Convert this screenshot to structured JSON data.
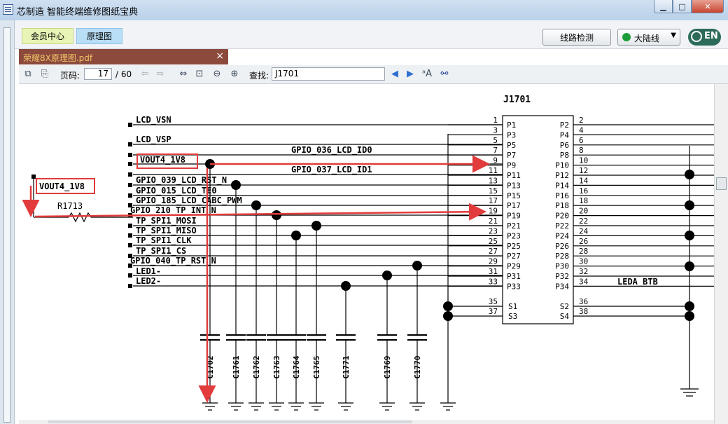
{
  "window": {
    "title": "芯制造 智能终端维修图纸宝典",
    "min": "▁",
    "max": "□",
    "close": "✕"
  },
  "nav": {
    "member_tab": "会员中心",
    "schematic_tab": "原理图",
    "line_check": "线路检测",
    "region": "大陆线",
    "lang": "EN"
  },
  "doc_tab": {
    "name": "荣耀8X原理图.pdf",
    "close": "×"
  },
  "toolbar": {
    "page_label": "页码:",
    "page_current": "17",
    "page_total": "/ 60",
    "find_label": "查找:",
    "find_value": "J1701"
  },
  "schematic": {
    "component": "J1701",
    "left_nets": [
      "LCD_VSN",
      "LCD_VSP",
      "GPIO_036_LCD_ID0",
      "VOUT4_1V8",
      "GPIO_037_LCD_ID1",
      "GPIO_039_LCD_RST_N",
      "GPIO_015_LCD_TE0",
      "GPIO_185_LCD_CABC_PWM",
      "GPIO_210_TP_INT_N",
      "TP_SPI1_MOSI",
      "TP_SPI1_MISO",
      "TP_SPI1_CLK",
      "TP_SPI1_CS",
      "GPIO_040_TP_RST_N",
      "LED1-",
      "LED2-"
    ],
    "left_pin_nums": [
      "1",
      "3",
      "5",
      "7",
      "9",
      "11",
      "13",
      "15",
      "17",
      "19",
      "21",
      "23",
      "25",
      "27",
      "29",
      "31",
      "33"
    ],
    "left_pin_names": [
      "P1",
      "P3",
      "P5",
      "P7",
      "P9",
      "P11",
      "P13",
      "P15",
      "P17",
      "P19",
      "P21",
      "P23",
      "P25",
      "P27",
      "P29",
      "P31",
      "P33"
    ],
    "right_pin_nums": [
      "2",
      "4",
      "6",
      "8",
      "10",
      "12",
      "14",
      "16",
      "18",
      "20",
      "22",
      "24",
      "26",
      "28",
      "30",
      "32",
      "34"
    ],
    "right_pin_names": [
      "P2",
      "P4",
      "P6",
      "P8",
      "P10",
      "P12",
      "P14",
      "P16",
      "P18",
      "P20",
      "P22",
      "P24",
      "P26",
      "P28",
      "P30",
      "P32",
      "P34"
    ],
    "shield_left": [
      {
        "num": "35",
        "name": "S1"
      },
      {
        "num": "37",
        "name": "S3"
      }
    ],
    "shield_right": [
      {
        "num": "36",
        "name": "S2"
      },
      {
        "num": "38",
        "name": "S4"
      }
    ],
    "right_net": "LEDA_BTB",
    "vout_label": "VOUT4_1V8",
    "resistor": "R1713",
    "caps": [
      "C1702",
      "C1761",
      "C1762",
      "C1763",
      "C1764",
      "C1765",
      "C1771",
      "C1769",
      "C1770"
    ]
  }
}
